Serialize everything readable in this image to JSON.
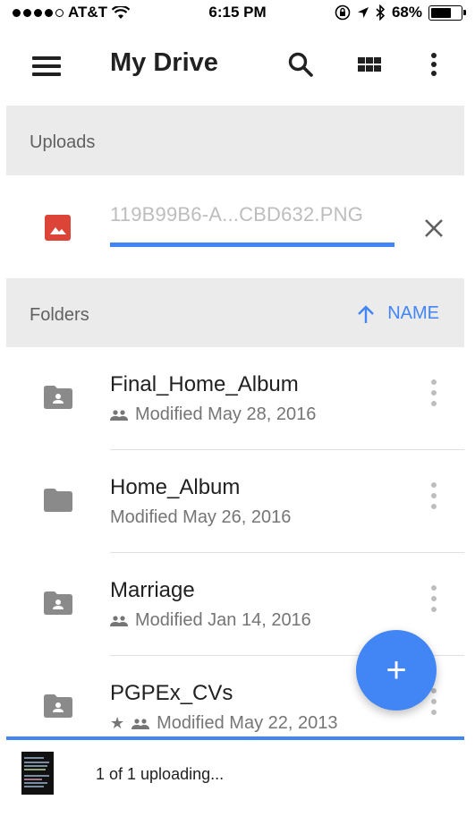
{
  "status_bar": {
    "carrier": "AT&T",
    "time": "6:15 PM",
    "battery_percent": "68%",
    "battery_level": 0.68,
    "signal_dots_filled": 4,
    "signal_dots_total": 5,
    "icons": [
      "wifi-icon",
      "rotation-lock-icon",
      "location-arrow-icon",
      "bluetooth-icon",
      "battery-icon"
    ]
  },
  "toolbar": {
    "title": "My Drive",
    "icons": [
      "menu-icon",
      "search-icon",
      "grid-view-icon",
      "more-vert-icon"
    ]
  },
  "uploads": {
    "header": "Uploads",
    "item": {
      "file_name": "119B99B6-A...CBD632.PNG",
      "progress": 1.0,
      "icon": "image-icon",
      "action_icon": "close-icon"
    }
  },
  "folders": {
    "header": "Folders",
    "sort_label": "NAME",
    "sort_icon": "arrow-up-icon",
    "items": [
      {
        "name": "Final_Home_Album",
        "modified": "Modified May 28, 2016",
        "shared": true,
        "starred": false
      },
      {
        "name": "Home_Album",
        "modified": "Modified May 26, 2016",
        "shared": false,
        "starred": false
      },
      {
        "name": "Marriage",
        "modified": "Modified Jan 14, 2016",
        "shared": true,
        "starred": false
      },
      {
        "name": "PGPEx_CVs",
        "modified": "Modified May 22, 2013",
        "shared": true,
        "starred": true
      }
    ]
  },
  "fab": {
    "label": "+",
    "icon": "plus-icon"
  },
  "bottom_bar": {
    "status": "1 of 1 uploading...",
    "progress": 1.0
  },
  "colors": {
    "accent": "#4285f4",
    "header_bg": "#ebebeb",
    "image_icon": "#db4437",
    "folder_icon": "#8a8a8a"
  }
}
